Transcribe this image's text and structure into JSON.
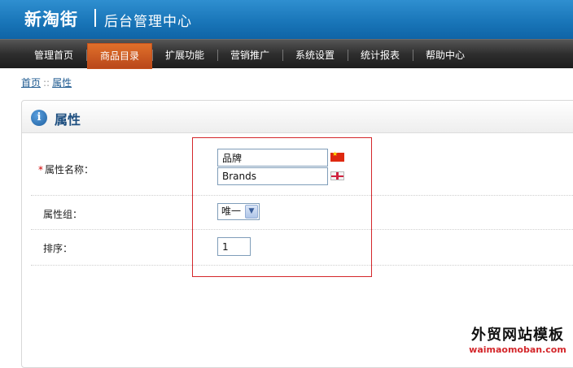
{
  "header": {
    "logo": "新淘街",
    "subtitle": "后台管理中心"
  },
  "nav": {
    "items": [
      {
        "label": "管理首页"
      },
      {
        "label": "商品目录",
        "active": true
      },
      {
        "label": "扩展功能"
      },
      {
        "label": "营销推广"
      },
      {
        "label": "系统设置"
      },
      {
        "label": "统计报表"
      },
      {
        "label": "帮助中心"
      }
    ]
  },
  "breadcrumb": {
    "home": "首页",
    "separator": "::",
    "current": "属性"
  },
  "panel": {
    "title": "属性",
    "info_icon": "i"
  },
  "form": {
    "required_mark": "*",
    "name_label": "属性名称：",
    "name_zh": "品牌",
    "name_en": "Brands",
    "flag_zh": "china-flag",
    "flag_en": "uk-flag",
    "group_label": "属性组：",
    "group_value": "唯一",
    "group_arrow": "▼",
    "sort_label": "排序：",
    "sort_value": "1"
  },
  "watermark": {
    "title": "外贸网站模板",
    "url": "waimaomoban.com"
  },
  "colors": {
    "header_blue": "#1874b7",
    "nav_active": "#d0602a",
    "highlight_red": "#d4272b",
    "title_blue": "#1e4f80"
  }
}
